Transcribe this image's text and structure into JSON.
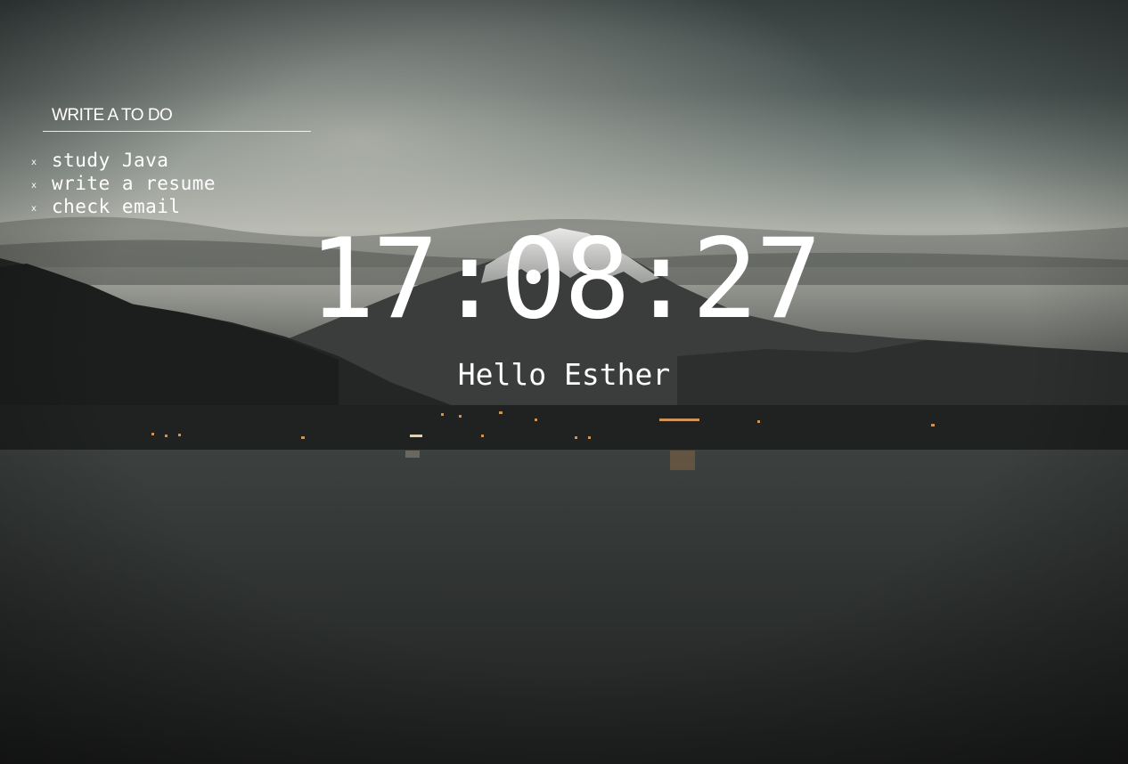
{
  "todo": {
    "placeholder": "WRITE A TO DO",
    "delete_label": "x",
    "items": [
      {
        "text": "study Java"
      },
      {
        "text": "write a resume"
      },
      {
        "text": "check email"
      }
    ]
  },
  "clock": {
    "time": "17:08:27"
  },
  "greeting": {
    "text": "Hello Esther"
  },
  "colors": {
    "text": "#ffffff",
    "sky_top": "#3f4a4a",
    "sky_glow": "#b8b8b0",
    "water": "#2a2c2b"
  },
  "background": {
    "icon": "mountain-lake-landscape-icon"
  }
}
